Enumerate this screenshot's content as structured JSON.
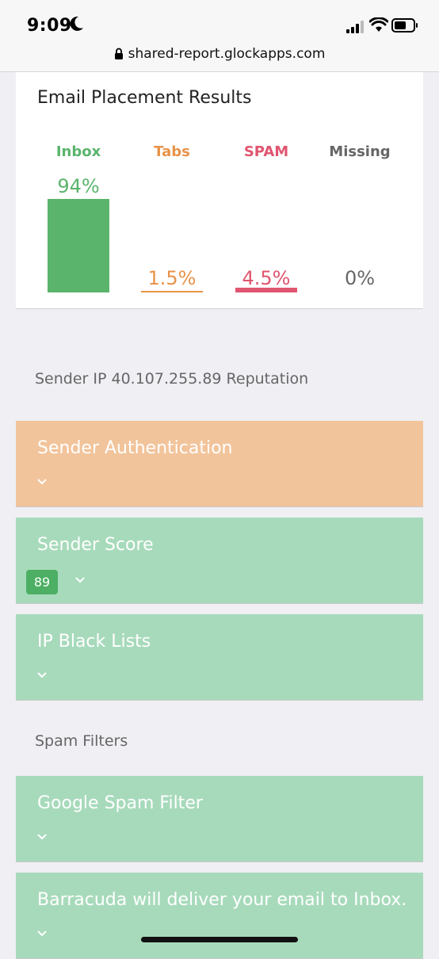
{
  "status_bar": {
    "time": "9:09"
  },
  "browser": {
    "url": "shared-report.glockapps.com"
  },
  "placement": {
    "title": "Email Placement Results",
    "columns": [
      {
        "label": "Inbox",
        "value_text": "94%",
        "value": 94,
        "color": "#5ab46c"
      },
      {
        "label": "Tabs",
        "value_text": "1.5%",
        "value": 1.5,
        "color": "#e8934a"
      },
      {
        "label": "SPAM",
        "value_text": "4.5%",
        "value": 4.5,
        "color": "#e05570"
      },
      {
        "label": "Missing",
        "value_text": "0%",
        "value": 0,
        "color": "#666666"
      }
    ]
  },
  "reputation": {
    "heading": "Sender IP 40.107.255.89 Reputation",
    "panels": [
      {
        "title": "Sender Authentication",
        "color": "#f2c49b"
      },
      {
        "title": "Sender Score",
        "color": "#a7dabb",
        "badge": "89"
      },
      {
        "title": "IP Black Lists",
        "color": "#a7dabb"
      }
    ]
  },
  "spam_filters": {
    "heading": "Spam Filters",
    "panels": [
      {
        "title": "Google Spam Filter",
        "color": "#a7dabb"
      },
      {
        "title": "Barracuda will deliver your email to Inbox.",
        "color": "#a7dabb"
      }
    ]
  }
}
